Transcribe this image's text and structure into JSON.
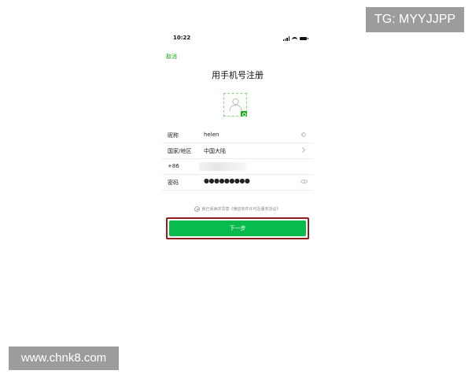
{
  "watermarks": {
    "top": "TG: MYYJJPP",
    "bottom": "www.chnk8.com"
  },
  "status_bar": {
    "time": "10:22",
    "icons": [
      "signal-icon",
      "wifi-icon",
      "battery-icon"
    ]
  },
  "nav": {
    "cancel_label": "取消",
    "title": "用手机号注册"
  },
  "avatar": {
    "icon": "user-avatar-icon",
    "badge_icon": "camera-icon"
  },
  "form": {
    "nickname": {
      "label": "昵称",
      "value": "helen",
      "icon": "clear-icon"
    },
    "region": {
      "label": "国家/地区",
      "value": "中国大陆",
      "icon": "chevron-right-icon"
    },
    "phone": {
      "label": "+86"
    },
    "password": {
      "label": "密码",
      "value": "●●●●●●●●●",
      "icon": "eye-icon"
    }
  },
  "agreement": {
    "text": "我已阅读并同意《微信软件许可及服务协议》"
  },
  "next_button": {
    "label": "下一步"
  },
  "colors": {
    "accent": "#1aad19",
    "button": "#09bb4d",
    "highlight": "#8e1f1f",
    "watermark_bg": "#9c9c9c"
  }
}
